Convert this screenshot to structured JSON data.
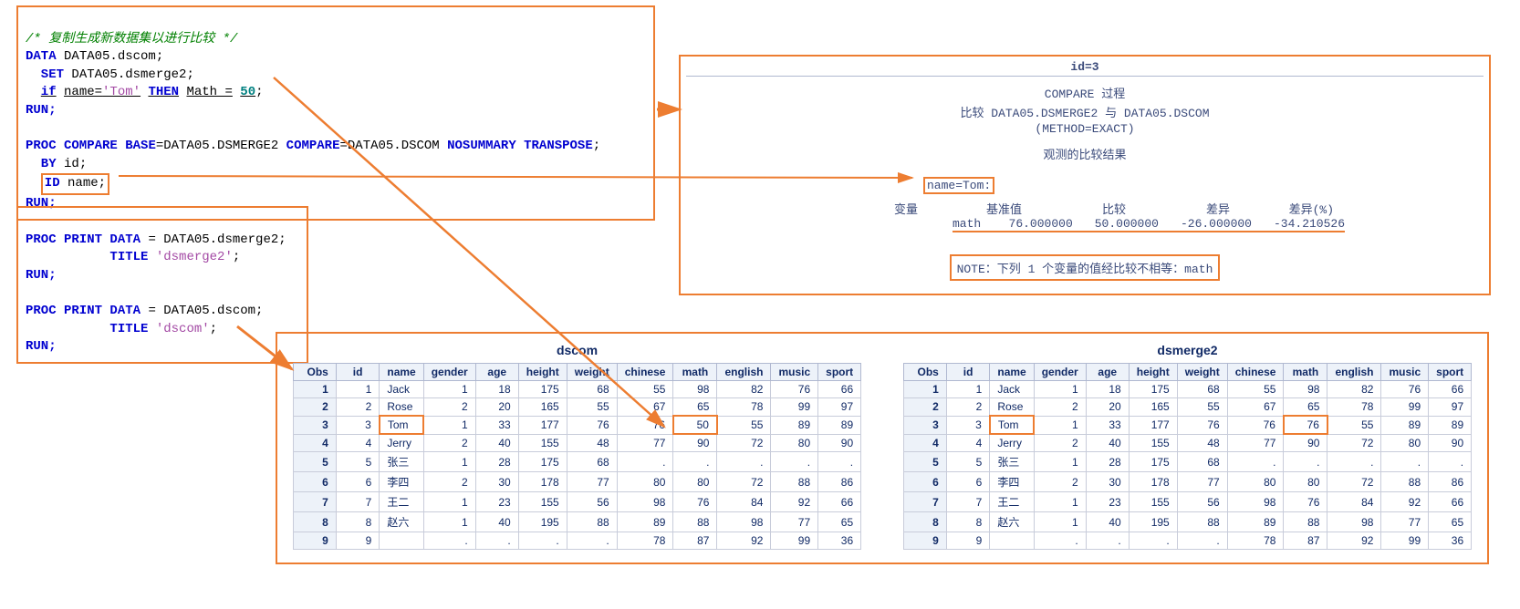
{
  "code1": {
    "comment": "/* 复制生成新数据集以进行比较 */",
    "l1_kw_data": "DATA",
    "l1_ident": "DATA05.dscom;",
    "l2_kw_set": "SET",
    "l2_ident": "DATA05.dsmerge2;",
    "l3_if": "if",
    "l3_cond": "name=",
    "l3_str": "'Tom'",
    "l3_then": "THEN",
    "l3_assign": "Math =",
    "l3_num": "50",
    "l3_semi": ";",
    "l4_run": "RUN;",
    "l6_proc": "PROC COMPARE",
    "l6_base": "BASE",
    "l6_eq1": "=DATA05.DSMERGE2",
    "l6_cmp": "COMPARE",
    "l6_eq2": "=DATA05.DSCOM",
    "l6_opts": "NOSUMMARY TRANSPOSE",
    "l6_semi": ";",
    "l7_by": "BY",
    "l7_id": "id;",
    "l8_idkw": "ID",
    "l8_name": "name;",
    "l9_run": "RUN;"
  },
  "code2": {
    "l1_proc": "PROC PRINT",
    "l1_data": "DATA",
    "l1_eq": "= DATA05.dsmerge2;",
    "l2_title": "TITLE",
    "l2_str": "'dsmerge2'",
    "l2_semi": ";",
    "l3_run": "RUN;",
    "l5_proc": "PROC PRINT",
    "l5_data": "DATA",
    "l5_eq": "= DATA05.dscom;",
    "l6_title": "TITLE",
    "l6_str": "'dscom'",
    "l6_semi": ";",
    "l7_run": "RUN;"
  },
  "compare": {
    "id_hdr": "id=3",
    "proc_line": "COMPARE 过程",
    "cmp_line": "比较 DATA05.DSMERGE2 与 DATA05.DSCOM",
    "method_line": "(METHOD=EXACT)",
    "obs_title": "观测的比较结果",
    "name_label": "name=Tom:",
    "hdr_var": "变量",
    "hdr_base": "基准值",
    "hdr_comp": "比较",
    "hdr_diff": "差异",
    "hdr_pct": "差异(%)",
    "row_var": "math",
    "row_base": "76.000000",
    "row_comp": "50.000000",
    "row_diff": "-26.000000",
    "row_pct": "-34.210526",
    "note": "NOTE：下列 1 个变量的值经比较不相等：math"
  },
  "tables": {
    "headers": [
      "Obs",
      "id",
      "name",
      "gender",
      "age",
      "height",
      "weight",
      "chinese",
      "math",
      "english",
      "music",
      "sport"
    ],
    "dscom_title": "dscom",
    "dsmerge2_title": "dsmerge2",
    "dscom_rows": [
      [
        "1",
        "1",
        "Jack",
        "1",
        "18",
        "175",
        "68",
        "55",
        "98",
        "82",
        "76",
        "66"
      ],
      [
        "2",
        "2",
        "Rose",
        "2",
        "20",
        "165",
        "55",
        "67",
        "65",
        "78",
        "99",
        "97"
      ],
      [
        "3",
        "3",
        "Tom",
        "1",
        "33",
        "177",
        "76",
        "76",
        "50",
        "55",
        "89",
        "89"
      ],
      [
        "4",
        "4",
        "Jerry",
        "2",
        "40",
        "155",
        "48",
        "77",
        "90",
        "72",
        "80",
        "90"
      ],
      [
        "5",
        "5",
        "张三",
        "1",
        "28",
        "175",
        "68",
        ".",
        ".",
        ".",
        ".",
        "."
      ],
      [
        "6",
        "6",
        "李四",
        "2",
        "30",
        "178",
        "77",
        "80",
        "80",
        "72",
        "88",
        "86"
      ],
      [
        "7",
        "7",
        "王二",
        "1",
        "23",
        "155",
        "56",
        "98",
        "76",
        "84",
        "92",
        "66"
      ],
      [
        "8",
        "8",
        "赵六",
        "1",
        "40",
        "195",
        "88",
        "89",
        "88",
        "98",
        "77",
        "65"
      ],
      [
        "9",
        "9",
        "",
        ".",
        ".",
        ".",
        ".",
        "78",
        "87",
        "92",
        "99",
        "36"
      ]
    ],
    "dsmerge2_rows": [
      [
        "1",
        "1",
        "Jack",
        "1",
        "18",
        "175",
        "68",
        "55",
        "98",
        "82",
        "76",
        "66"
      ],
      [
        "2",
        "2",
        "Rose",
        "2",
        "20",
        "165",
        "55",
        "67",
        "65",
        "78",
        "99",
        "97"
      ],
      [
        "3",
        "3",
        "Tom",
        "1",
        "33",
        "177",
        "76",
        "76",
        "76",
        "55",
        "89",
        "89"
      ],
      [
        "4",
        "4",
        "Jerry",
        "2",
        "40",
        "155",
        "48",
        "77",
        "90",
        "72",
        "80",
        "90"
      ],
      [
        "5",
        "5",
        "张三",
        "1",
        "28",
        "175",
        "68",
        ".",
        ".",
        ".",
        ".",
        "."
      ],
      [
        "6",
        "6",
        "李四",
        "2",
        "30",
        "178",
        "77",
        "80",
        "80",
        "72",
        "88",
        "86"
      ],
      [
        "7",
        "7",
        "王二",
        "1",
        "23",
        "155",
        "56",
        "98",
        "76",
        "84",
        "92",
        "66"
      ],
      [
        "8",
        "8",
        "赵六",
        "1",
        "40",
        "195",
        "88",
        "89",
        "88",
        "98",
        "77",
        "65"
      ],
      [
        "9",
        "9",
        "",
        ".",
        ".",
        ".",
        ".",
        "78",
        "87",
        "92",
        "99",
        "36"
      ]
    ]
  },
  "chart_data": {
    "type": "table",
    "title": "PROC COMPARE result math: base=76 compare=50 diff=-26 pct=-34.210526",
    "series": [
      {
        "name": "dscom",
        "columns": [
          "Obs",
          "id",
          "name",
          "gender",
          "age",
          "height",
          "weight",
          "chinese",
          "math",
          "english",
          "music",
          "sport"
        ]
      },
      {
        "name": "dsmerge2",
        "columns": [
          "Obs",
          "id",
          "name",
          "gender",
          "age",
          "height",
          "weight",
          "chinese",
          "math",
          "english",
          "music",
          "sport"
        ]
      }
    ]
  }
}
